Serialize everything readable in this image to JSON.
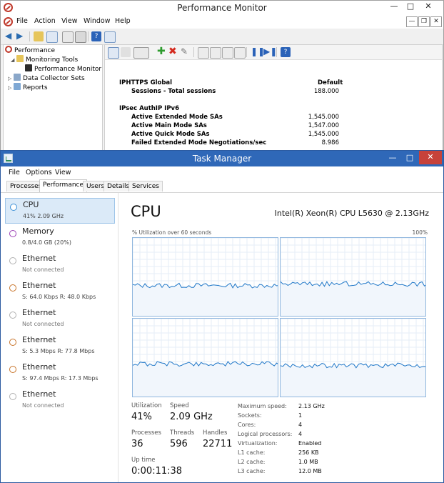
{
  "perfmon": {
    "title": "Performance Monitor",
    "menu": [
      "File",
      "Action",
      "View",
      "Window",
      "Help"
    ],
    "tree": [
      {
        "label": "Performance",
        "level": 0
      },
      {
        "label": "Monitoring Tools",
        "level": 1
      },
      {
        "label": "Performance Monitor",
        "level": 2
      },
      {
        "label": "Data Collector Sets",
        "level": 1
      },
      {
        "label": "Reports",
        "level": 1
      }
    ],
    "report": {
      "header_value": "Default",
      "groups": [
        {
          "name": "IPHTTPS Global",
          "rows": [
            {
              "counter": "Sessions - Total sessions",
              "value": "188.000"
            }
          ]
        },
        {
          "name": "IPsec AuthIP IPv6",
          "rows": [
            {
              "counter": "Active Extended Mode SAs",
              "value": "1,545.000"
            },
            {
              "counter": "Active Main Mode SAs",
              "value": "1,547.000"
            },
            {
              "counter": "Active Quick Mode SAs",
              "value": "1,545.000"
            },
            {
              "counter": "Failed Extended Mode Negotiations/sec",
              "value": "8.986"
            }
          ]
        }
      ]
    }
  },
  "taskmgr": {
    "title": "Task Manager",
    "menu": [
      "File",
      "Options",
      "View"
    ],
    "tabs": [
      "Processes",
      "Performance",
      "Users",
      "Details",
      "Services"
    ],
    "active_tab": "Performance",
    "resources": [
      {
        "name": "CPU",
        "sub": "41%  2.09 GHz",
        "color": "#3a8fd6",
        "active": true
      },
      {
        "name": "Memory",
        "sub": "0.8/4.0 GB (20%)",
        "color": "#9b3fb5",
        "active": false
      },
      {
        "name": "Ethernet",
        "sub": "Not connected",
        "color": "#b0b0b0",
        "active": false
      },
      {
        "name": "Ethernet",
        "sub": "S: 64.0 Kbps  R: 48.0 Kbps",
        "color": "#c8742a",
        "active": false
      },
      {
        "name": "Ethernet",
        "sub": "Not connected",
        "color": "#b0b0b0",
        "active": false
      },
      {
        "name": "Ethernet",
        "sub": "S: 5.3 Mbps  R: 77.8 Mbps",
        "color": "#c8742a",
        "active": false
      },
      {
        "name": "Ethernet",
        "sub": "S: 97.4 Mbps  R: 17.3 Mbps",
        "color": "#c8742a",
        "active": false
      },
      {
        "name": "Ethernet",
        "sub": "Not connected",
        "color": "#b0b0b0",
        "active": false
      }
    ],
    "cpu": {
      "title": "CPU",
      "model": "Intel(R) Xeon(R) CPU L5630 @ 2.13GHz",
      "util_label": "% Utilization over 60 seconds",
      "util_max": "100%",
      "line_color": "#1f77c8",
      "cores_util_pct": [
        40,
        42,
        43,
        41
      ],
      "stats": {
        "utilization": {
          "label": "Utilization",
          "value": "41%"
        },
        "speed": {
          "label": "Speed",
          "value": "2.09 GHz"
        },
        "processes": {
          "label": "Processes",
          "value": "36"
        },
        "threads": {
          "label": "Threads",
          "value": "596"
        },
        "handles": {
          "label": "Handles",
          "value": "22711"
        },
        "uptime": {
          "label": "Up time",
          "value": "0:00:11:38"
        }
      },
      "specs": [
        {
          "k": "Maximum speed:",
          "v": "2.13 GHz"
        },
        {
          "k": "Sockets:",
          "v": "1"
        },
        {
          "k": "Cores:",
          "v": "4"
        },
        {
          "k": "Logical processors:",
          "v": "4"
        },
        {
          "k": "Virtualization:",
          "v": "Enabled"
        },
        {
          "k": "L1 cache:",
          "v": "256 KB"
        },
        {
          "k": "L2 cache:",
          "v": "1.0 MB"
        },
        {
          "k": "L3 cache:",
          "v": "12.0 MB"
        }
      ]
    }
  }
}
